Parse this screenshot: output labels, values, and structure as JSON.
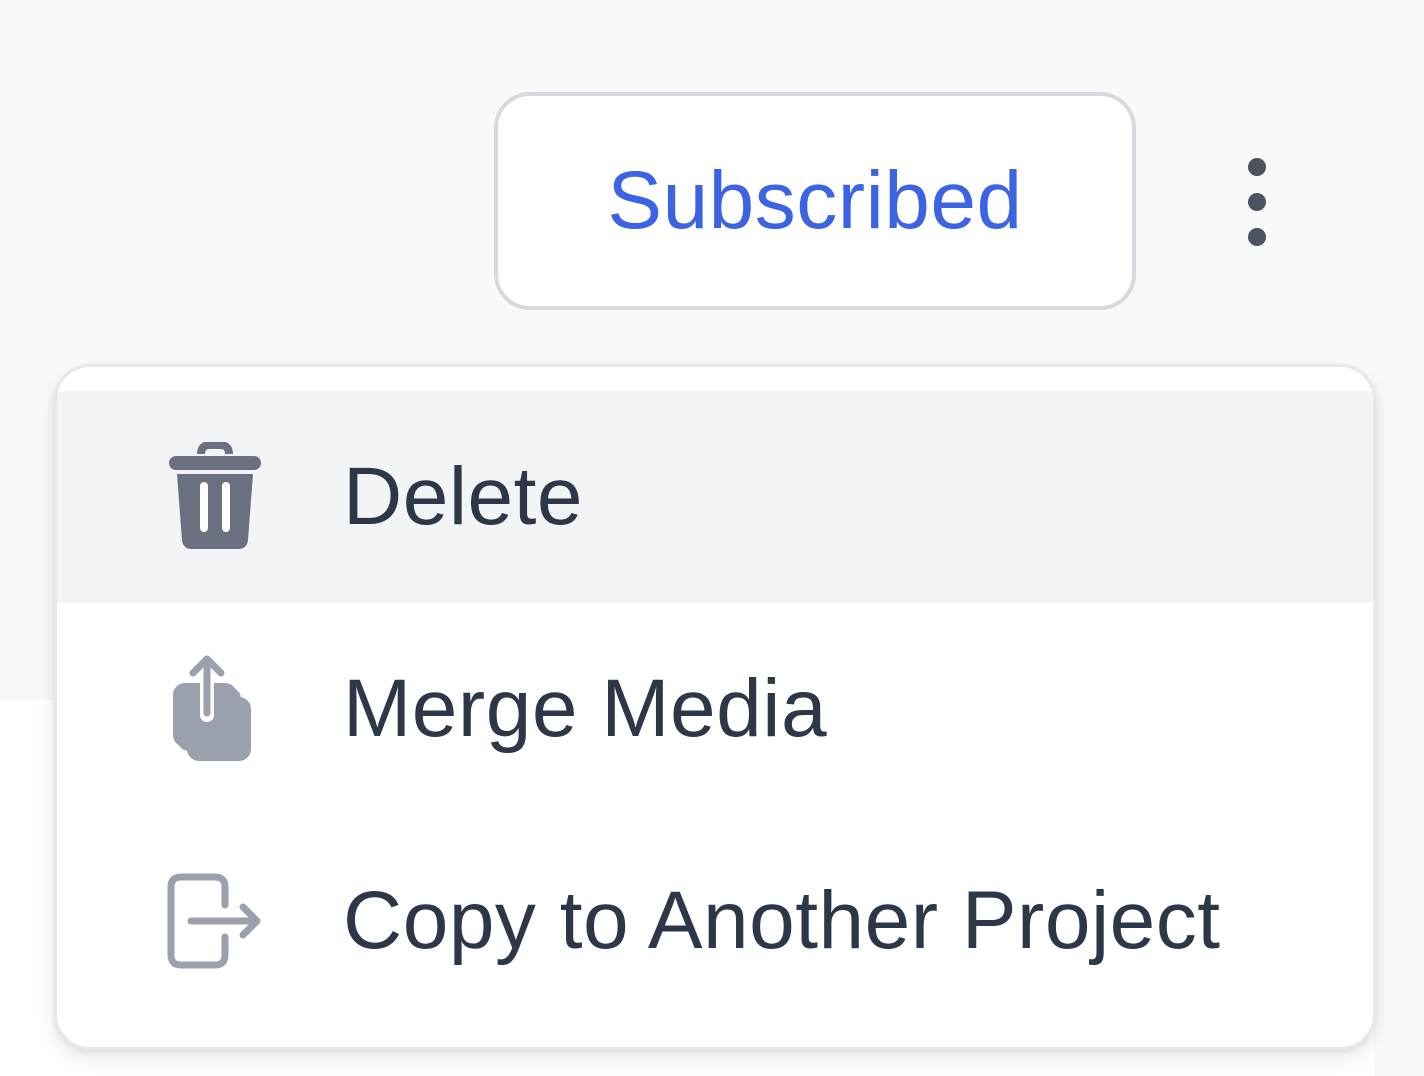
{
  "header": {
    "subscribe_label": "Subscribed",
    "more_icon": "more-vertical-icon"
  },
  "menu": {
    "items": [
      {
        "label": "Delete",
        "icon": "trash-icon",
        "active": true
      },
      {
        "label": "Merge Media",
        "icon": "merge-icon",
        "active": false
      },
      {
        "label": "Copy to Another Project",
        "icon": "copy-to-project-icon",
        "active": false
      }
    ]
  },
  "colors": {
    "accent": "#3b63e4",
    "text": "#2d3748",
    "icon_dark": "#6b7080",
    "icon_light": "#9aa1ad",
    "hover_bg": "#f3f4f6",
    "page_bg": "#f8f9fb"
  }
}
